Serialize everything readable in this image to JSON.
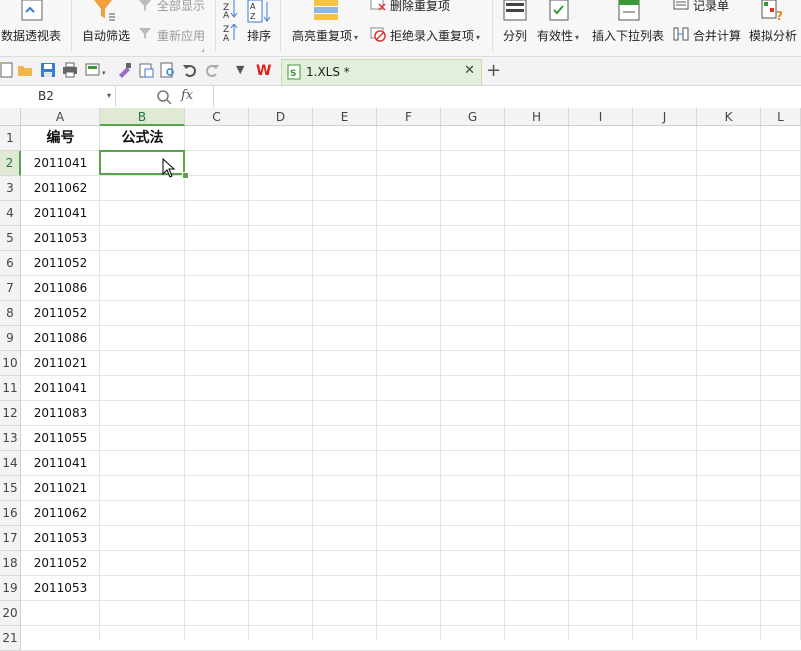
{
  "ribbon": {
    "pivot_table": "数据透视表",
    "auto_filter": "自动筛选",
    "show_all": "全部显示",
    "reapply": "重新应用",
    "sort": "排序",
    "highlight_duplicates": "高亮重复项",
    "delete_duplicates": "删除重复项",
    "reject_duplicates": "拒绝录入重复项",
    "split_columns": "分列",
    "validity": "有效性",
    "insert_dropdown": "插入下拉列表",
    "record_sheet": "记录单",
    "merge_calc": "合并计算",
    "simulation": "模拟分析"
  },
  "tabs": {
    "doc_name": "1.XLS *"
  },
  "formula_bar": {
    "name_box": "B2",
    "fx": "fx",
    "content": ""
  },
  "columns": [
    "A",
    "B",
    "C",
    "D",
    "E",
    "F",
    "G",
    "H",
    "I",
    "J",
    "K",
    "L"
  ],
  "rows": [
    "1",
    "2",
    "3",
    "4",
    "5",
    "6",
    "7",
    "8",
    "9",
    "10",
    "11",
    "12",
    "13",
    "14",
    "15",
    "16",
    "17",
    "18",
    "19",
    "20",
    "21"
  ],
  "active_cell": "B2",
  "table": {
    "header_a": "编号",
    "header_b": "公式法",
    "values": [
      "2011041",
      "2011062",
      "2011041",
      "2011053",
      "2011052",
      "2011086",
      "2011052",
      "2011086",
      "2011021",
      "2011041",
      "2011083",
      "2011055",
      "2011041",
      "2011021",
      "2011062",
      "2011053",
      "2011052",
      "2011053"
    ]
  },
  "colors": {
    "accent": "#58a34a",
    "tab_bg": "#e2efda"
  }
}
